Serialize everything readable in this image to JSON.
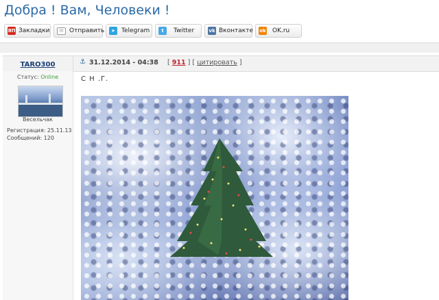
{
  "page": {
    "title": "Добра ! Вам, Человеки !"
  },
  "share": {
    "buttons": [
      {
        "label": "Закладки",
        "icon": "ya-bookmarks-icon",
        "color": "#d62b20"
      },
      {
        "label": "Отправить",
        "icon": "mail-icon",
        "color": "#9a9a9a"
      },
      {
        "label": "Telegram",
        "icon": "telegram-icon",
        "color": "#2ca5e0"
      },
      {
        "label": "Twitter",
        "icon": "twitter-icon",
        "color": "#48a8e6"
      },
      {
        "label": "Вконтакте",
        "icon": "vk-icon",
        "color": "#4c75a3"
      },
      {
        "label": "OK.ru",
        "icon": "ok-icon",
        "color": "#ee8208"
      }
    ]
  },
  "post": {
    "author": "TARO300",
    "date": "31.12.2014 - 04:38",
    "number": "911",
    "quote_label": "цитировать",
    "text": "С Н .Г.",
    "status_label": "Статус:",
    "status_value": "Online",
    "rank": "Весельчак",
    "registration": "Регистрация: 25.11.13",
    "messages": "Сообщений: 120"
  },
  "colors": {
    "title": "#2a6aa6",
    "author_link": "#1c3f78",
    "post_number": "#c0272d",
    "status_online": "#35a035"
  }
}
